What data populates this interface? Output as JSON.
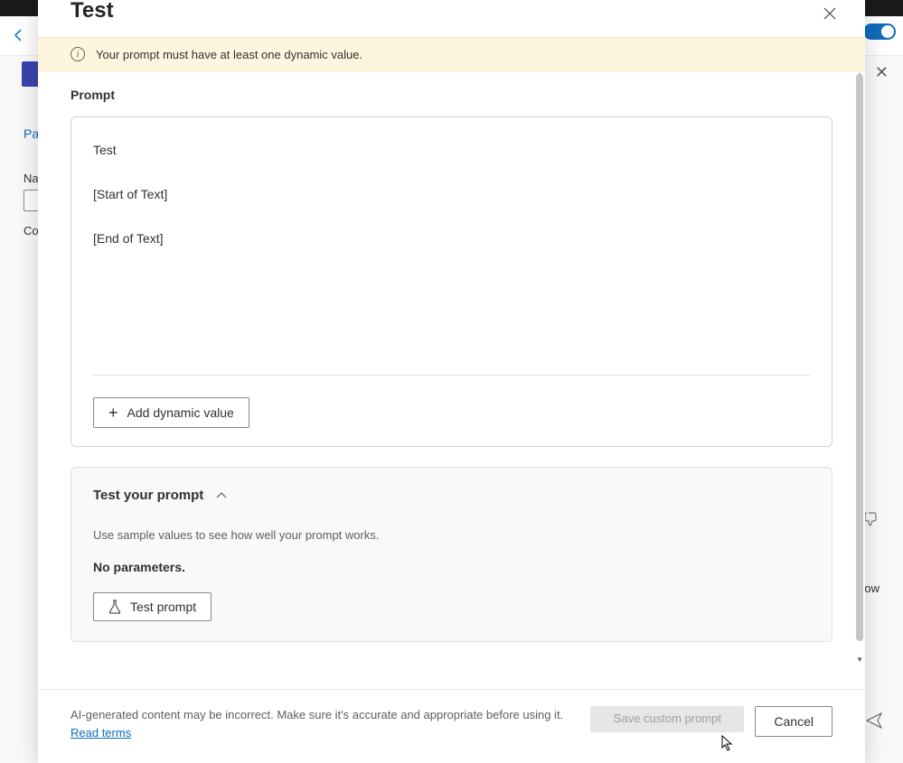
{
  "modal": {
    "title": "Test",
    "warning": "Your prompt must have at least one dynamic value.",
    "prompt_section_label": "Prompt",
    "prompt_lines": {
      "line1": "Test",
      "line2": "[Start of Text]",
      "line3": "[End of Text]"
    },
    "add_dynamic_label": "Add dynamic value",
    "test_section": {
      "title": "Test your prompt",
      "hint": "Use sample values to see how well your prompt works.",
      "no_params": "No parameters.",
      "test_button": "Test prompt"
    },
    "footer": {
      "disclaimer_text": "AI-generated content may be incorrect. Make sure it's accurate and appropriate before using it. ",
      "link_text": "Read terms",
      "save_button": "Save custom prompt",
      "cancel_button": "Cancel"
    }
  },
  "background": {
    "tab": "Pa",
    "name_label": "Na",
    "co_label": "Co",
    "flow_label": "flow"
  }
}
